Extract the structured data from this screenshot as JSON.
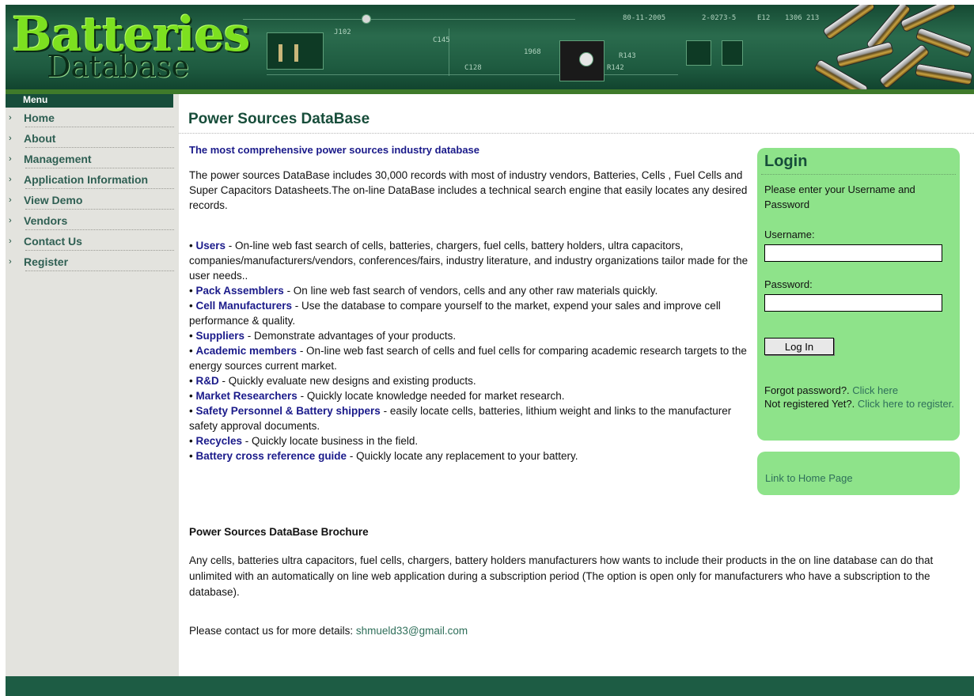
{
  "header": {
    "logo_main": "Batteries",
    "logo_sub": "Database",
    "board_codes": [
      "80-11-2005",
      "2-0273-5",
      "E12",
      "1306",
      "213",
      "R143",
      "C145",
      "R142",
      "C128",
      "1968",
      "J102"
    ]
  },
  "sidebar": {
    "title": "Menu",
    "items": [
      {
        "label": "Home"
      },
      {
        "label": "About"
      },
      {
        "label": "Management"
      },
      {
        "label": "Application Information"
      },
      {
        "label": "View Demo"
      },
      {
        "label": "Vendors"
      },
      {
        "label": "Contact Us"
      },
      {
        "label": "Register"
      }
    ]
  },
  "main": {
    "title": "Power Sources DataBase",
    "tagline": "The most comprehensive power sources industry database",
    "intro": "The  power sources DataBase includes 30,000 records with most of  industry vendors, Batteries,  Cells , Fuel Cells and Super Capacitors Datasheets.The on-line DataBase includes a technical search engine that easily locates any desired records.",
    "bullets": [
      {
        "term": "Users",
        "text": " - On-line web fast search of cells, batteries, chargers, fuel cells, battery holders, ultra capacitors, companies/manufacturers/vendors, conferences/fairs, industry literature, and industry organizations tailor made for the user needs.."
      },
      {
        "term": "Pack Assemblers",
        "text": " - On line web fast search of vendors, cells and any other raw materials quickly."
      },
      {
        "term": "Cell Manufacturers",
        "text": " - Use the database to compare yourself to the market, expend your sales and improve cell performance & quality."
      },
      {
        "term": "Suppliers",
        "text": " - Demonstrate advantages of your products."
      },
      {
        "term": "Academic members",
        "text": " - On-line web fast search of cells and fuel cells for comparing academic research targets to the energy sources current market."
      },
      {
        "term": "R&D",
        "text": " - Quickly evaluate new designs and existing products."
      },
      {
        "term": "Market Researchers",
        "text": " - Quickly locate knowledge needed for market research."
      },
      {
        "term": "Safety Personnel & Battery shippers",
        "text": " - easily locate cells, batteries, lithium weight and links to the manufacturer safety approval documents."
      },
      {
        "term": "Recycles",
        "text": " - Quickly locate business in the field."
      },
      {
        "term": "Battery cross reference guide",
        "text": " - Quickly locate any replacement to your battery."
      }
    ],
    "brochure_title": "Power Sources DataBase Brochure",
    "brochure_text": "Any cells, batteries ultra capacitors, fuel cells, chargers, battery holders manufacturers how wants to include their products in the on line database can do that unlimited with an automatically on line web application during a subscription period (The option is open only for manufacturers who have a subscription to the database).",
    "contact_prefix": "Please contact us for more details: ",
    "contact_email": "shmueld33@gmail.com"
  },
  "login": {
    "title": "Login",
    "intro": "Please enter your Username and Password",
    "username_label": "Username:",
    "username_value": "",
    "password_label": "Password:",
    "password_value": "",
    "button": "Log In",
    "forgot_text": "Forgot password?. ",
    "forgot_link": "Click here",
    "register_text": "Not registered Yet?. ",
    "register_link": "Click here to register."
  },
  "home_link": "Link to Home Page",
  "colors": {
    "brand_dark": "#174d3a",
    "login_bg": "#8ee38a",
    "link": "#2f6f5a",
    "term": "#1a1a8a",
    "footer": "#1d5c44"
  }
}
